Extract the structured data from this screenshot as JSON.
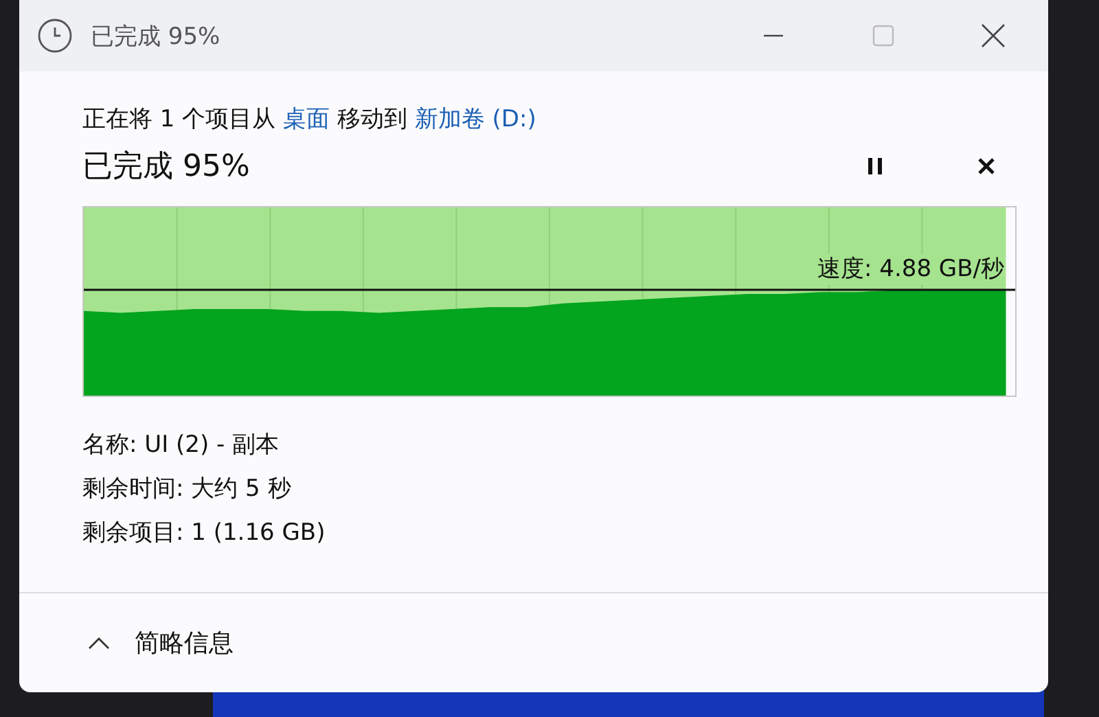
{
  "window": {
    "title": "已完成 95%"
  },
  "description": [
    {
      "kind": "text",
      "text": "正在将 1 个项目从"
    },
    {
      "kind": "link",
      "text": "桌面"
    },
    {
      "kind": "text",
      "text": "移动到"
    },
    {
      "kind": "link",
      "text": "新加卷 (D:)"
    }
  ],
  "progress": {
    "heading": "已完成 95%",
    "speed": "速度: 4.88 GB/秒",
    "level": 0.99
  },
  "details": [
    "名称: UI (2) - 副本",
    "剩余时间: 大约 5 秒",
    "剩余项目: 1 (1.16 GB)"
  ],
  "toggle": {
    "label": "简略信息",
    "expanded": true
  }
}
